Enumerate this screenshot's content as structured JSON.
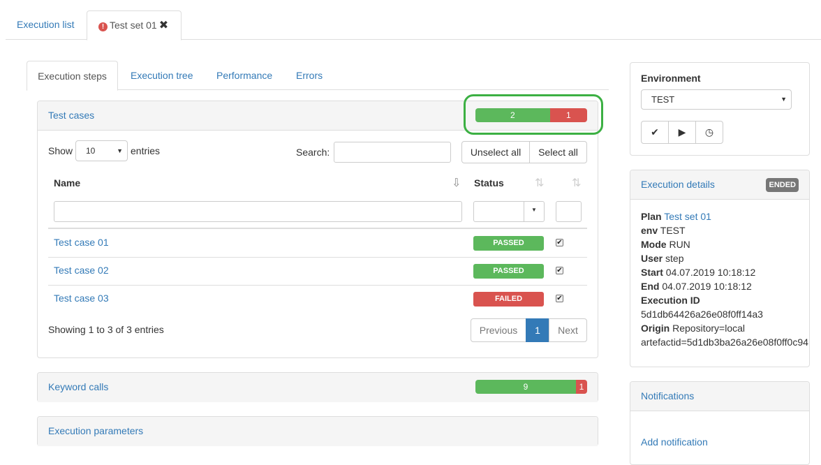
{
  "top_tabs": {
    "execution_list": "Execution list",
    "test_set": "Test set 01"
  },
  "inner_tabs": [
    "Execution steps",
    "Execution tree",
    "Performance",
    "Errors"
  ],
  "test_cases": {
    "title": "Test cases",
    "summary": {
      "passed": 2,
      "failed": 1
    },
    "show_label": "Show",
    "page_size": "10",
    "entries_label": "entries",
    "search_label": "Search:",
    "search_value": "",
    "unselect_all": "Unselect all",
    "select_all": "Select all",
    "columns": {
      "name": "Name",
      "status": "Status"
    },
    "rows": [
      {
        "name": "Test case 01",
        "status": "PASSED",
        "checked": true
      },
      {
        "name": "Test case 02",
        "status": "PASSED",
        "checked": true
      },
      {
        "name": "Test case 03",
        "status": "FAILED",
        "checked": true
      }
    ],
    "info": "Showing 1 to 3 of 3 entries",
    "pagination": {
      "previous": "Previous",
      "current": "1",
      "next": "Next"
    }
  },
  "keyword_calls": {
    "title": "Keyword calls",
    "summary": {
      "passed": 9,
      "failed": 1
    }
  },
  "execution_parameters": {
    "title": "Execution parameters"
  },
  "environment": {
    "title": "Environment",
    "selected": "TEST",
    "buttons": [
      "check-icon",
      "play-icon",
      "clock-icon"
    ]
  },
  "execution_details": {
    "title": "Execution details",
    "badge": "ENDED",
    "plan_label": "Plan",
    "plan_value": "Test set 01",
    "env_label": "env",
    "env_value": "TEST",
    "mode_label": "Mode",
    "mode_value": "RUN",
    "user_label": "User",
    "user_value": "step",
    "start_label": "Start",
    "start_value": "04.07.2019 10:18:12",
    "end_label": "End",
    "end_value": "04.07.2019 10:18:12",
    "execid_label": "Execution ID",
    "execid_value": "5d1db64426a26e08f0ff14a3",
    "origin_label": "Origin",
    "origin_value": "Repository=local",
    "origin_value2": "artefactid=5d1db3ba26a26e08f0ff0c94"
  },
  "notifications": {
    "title": "Notifications",
    "add": "Add notification"
  },
  "colors": {
    "accent": "#337ab7",
    "passed": "#5cb85c",
    "failed": "#d9534f",
    "highlight": "#3cb043"
  }
}
